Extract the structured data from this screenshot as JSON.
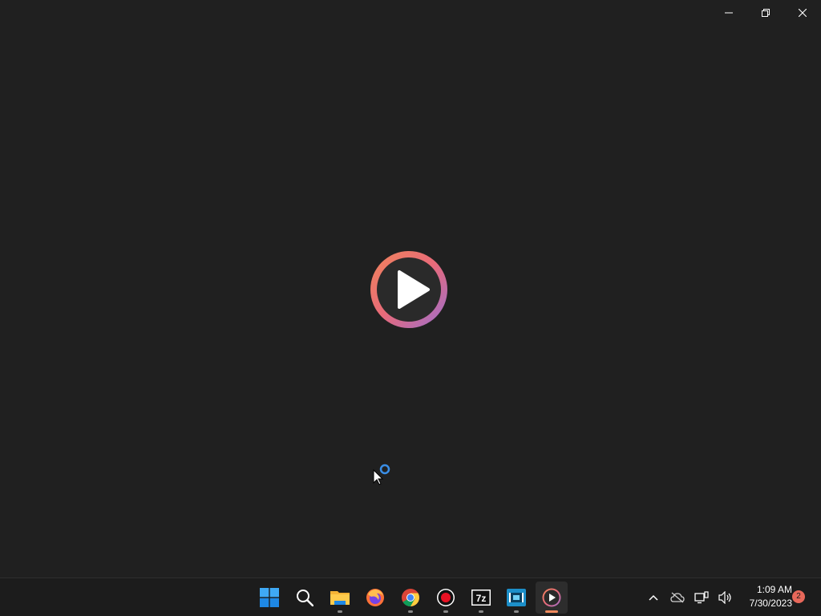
{
  "window": {
    "controls": [
      "minimize",
      "restore",
      "close"
    ],
    "splash_icon": "media-player-play-icon",
    "accent_gradient": [
      "#f0845a",
      "#e86a7a",
      "#9b6fd0"
    ]
  },
  "taskbar": {
    "pinned": [
      {
        "icon": "windows-start-icon",
        "running": false
      },
      {
        "icon": "search-icon",
        "running": false
      },
      {
        "icon": "file-explorer-icon",
        "running": true
      },
      {
        "icon": "firefox-icon",
        "running": false
      },
      {
        "icon": "chrome-icon",
        "running": true
      },
      {
        "icon": "screen-recorder-icon",
        "running": true
      },
      {
        "icon": "7zip-icon",
        "running": true
      },
      {
        "icon": "video-editor-icon",
        "running": true
      },
      {
        "icon": "media-player-icon",
        "running": true,
        "active": true
      }
    ],
    "seven_zip_label": "7z",
    "tray": {
      "icons": [
        "chevron-up-icon",
        "onedrive-offline-icon",
        "network-icon",
        "volume-icon"
      ],
      "time": "1:09 AM",
      "date": "7/30/2023",
      "notification_count": "2"
    }
  },
  "colors": {
    "background": "#202020",
    "taskbar": "#1c1c1c",
    "active_indicator": "#f08a5d",
    "badge": "#e8685a",
    "busy_cursor": "#3a8ee6"
  }
}
